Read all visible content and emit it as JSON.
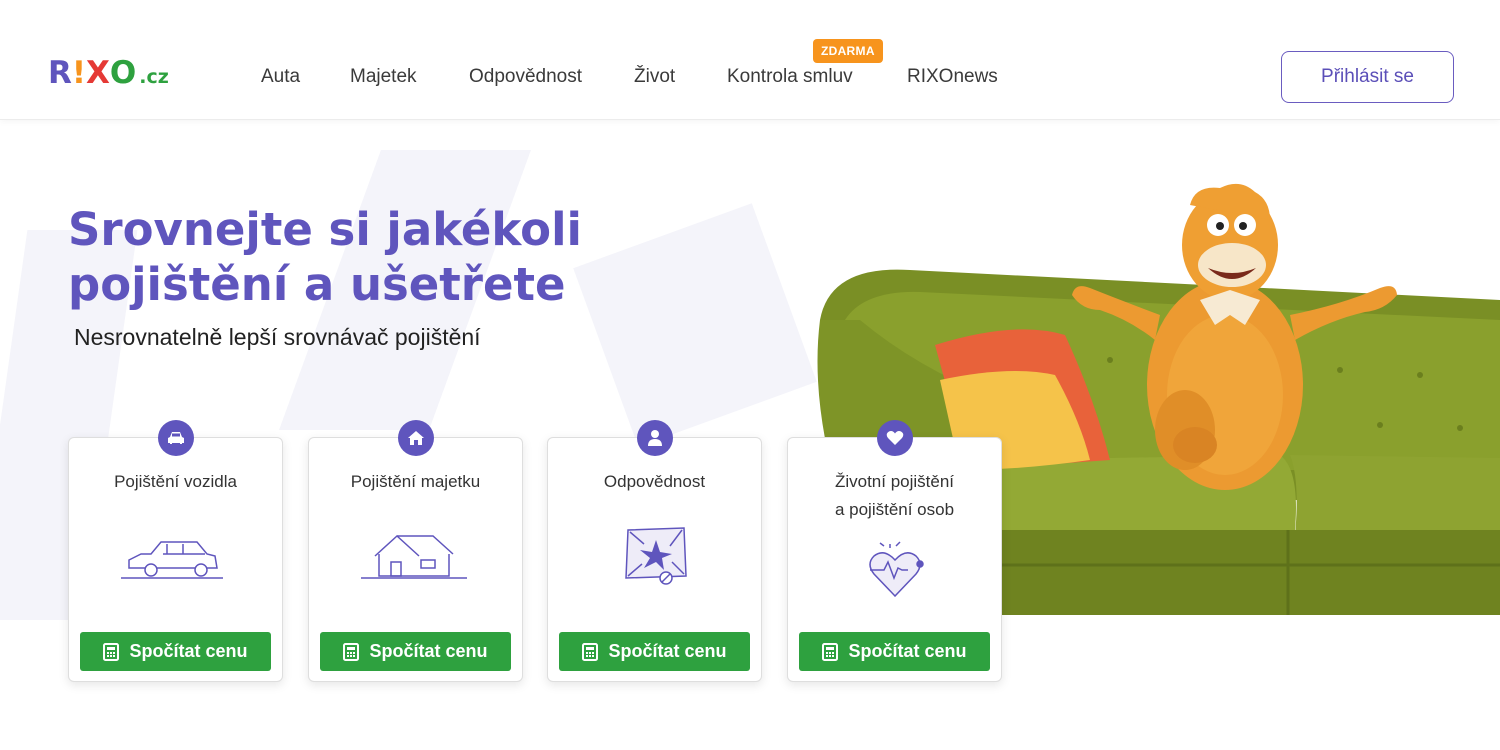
{
  "header": {
    "logo": {
      "parts": [
        "R",
        "!",
        "X",
        "O"
      ],
      "tld": ".cz",
      "colors": [
        "#5f55bd",
        "#f7941d",
        "#e53935",
        "#2ea13f"
      ]
    },
    "nav": [
      {
        "label": "Auta"
      },
      {
        "label": "Majetek"
      },
      {
        "label": "Odpovědnost"
      },
      {
        "label": "Život"
      },
      {
        "label": "Kontrola smluv"
      },
      {
        "label": "RIXOnews"
      }
    ],
    "badge": "ZDARMA",
    "login_label": "Přihlásit se"
  },
  "hero": {
    "title_line1": "Srovnejte si jakékoli",
    "title_line2": "pojištění a ušetřete",
    "subtitle": "Nesrovnatelně lepší srovnávač pojištění"
  },
  "cards": [
    {
      "title_line1": "Pojištění vozidla",
      "title_line2": "",
      "icon": "car-icon",
      "button": "Spočítat cenu"
    },
    {
      "title_line1": "Pojištění majetku",
      "title_line2": "",
      "icon": "home-icon",
      "button": "Spočítat cenu"
    },
    {
      "title_line1": "Odpovědnost",
      "title_line2": "",
      "icon": "person-icon",
      "button": "Spočítat cenu"
    },
    {
      "title_line1": "Životní pojištění",
      "title_line2": "a pojištění osob",
      "icon": "heart-icon",
      "button": "Spočítat cenu"
    }
  ],
  "colors": {
    "brand_purple": "#5f55bd",
    "accent_orange": "#f7941d",
    "cta_green": "#2ea13f"
  }
}
